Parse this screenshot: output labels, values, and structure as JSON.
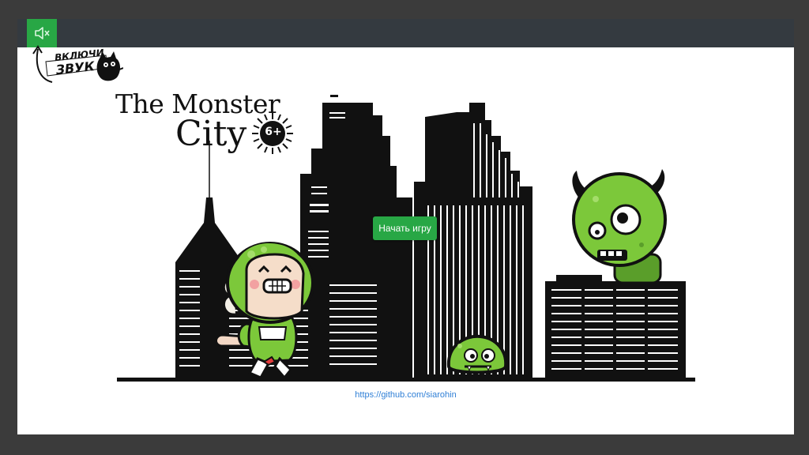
{
  "header": {
    "sound_icon": "speaker-muted-icon",
    "hint_lines": [
      "ВКЛЮЧИ",
      "ЗВУК"
    ]
  },
  "game": {
    "title_line1": "The Monster",
    "title_line2": "City",
    "age_rating": "6+",
    "start_button": "Начать игру",
    "repo_link": "https://github.com/siarohin"
  },
  "colors": {
    "accent": "#28a745",
    "topbar": "#343a40",
    "background": "#3b3b3b",
    "monster": "#7cc83a",
    "link": "#2f7fd6"
  }
}
